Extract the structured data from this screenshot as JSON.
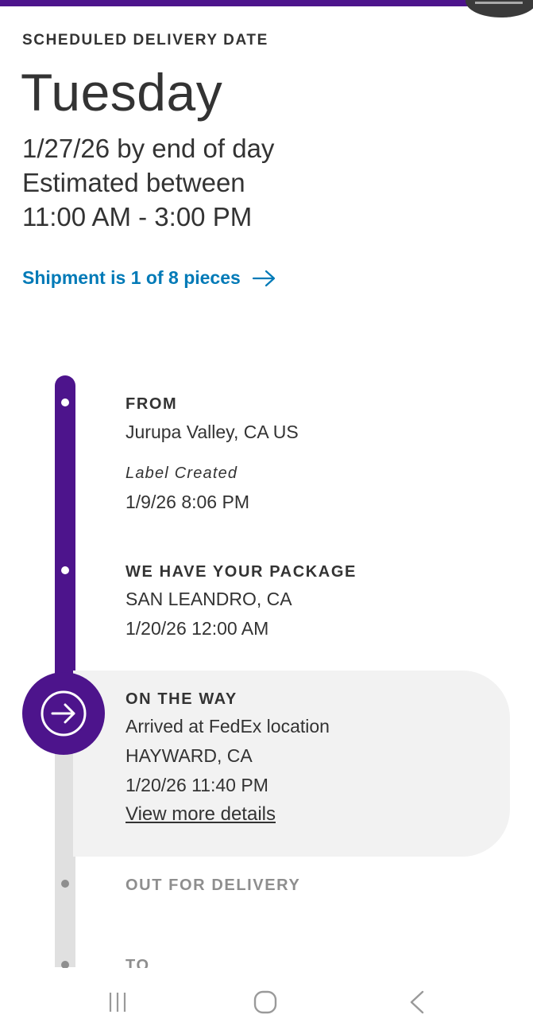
{
  "header": {
    "label": "SCHEDULED DELIVERY DATE",
    "day": "Tuesday",
    "date_line": "1/27/26 by end of day",
    "estimate_line": "Estimated between",
    "time_window": "11:00 AM - 3:00 PM"
  },
  "shipment_link": {
    "label": "Shipment is 1 of 8 pieces",
    "icon": "arrow-right-icon",
    "color": "#007ab7"
  },
  "colors": {
    "brand_purple": "#4d148c",
    "muted_gray": "#8e8e8e",
    "card_bg": "#f2f2f2"
  },
  "timeline": {
    "from": {
      "heading": "FROM",
      "location": "Jurupa Valley, CA US",
      "status": "Label Created",
      "timestamp": "1/9/26 8:06 PM"
    },
    "picked_up": {
      "heading": "WE HAVE YOUR PACKAGE",
      "location": "SAN LEANDRO, CA",
      "timestamp": "1/20/26 12:00 AM"
    },
    "on_the_way": {
      "heading": "ON THE WAY",
      "status": "Arrived at FedEx location",
      "location": "HAYWARD, CA",
      "timestamp": "1/20/26 11:40 PM",
      "details_link": "View more details",
      "icon": "arrow-circle-right-icon"
    },
    "out_for_delivery": {
      "heading": "OUT FOR DELIVERY"
    },
    "to": {
      "heading": "TO"
    }
  },
  "system_nav": {
    "recents_icon": "recent-apps-icon",
    "home_icon": "home-icon",
    "back_icon": "back-icon"
  }
}
